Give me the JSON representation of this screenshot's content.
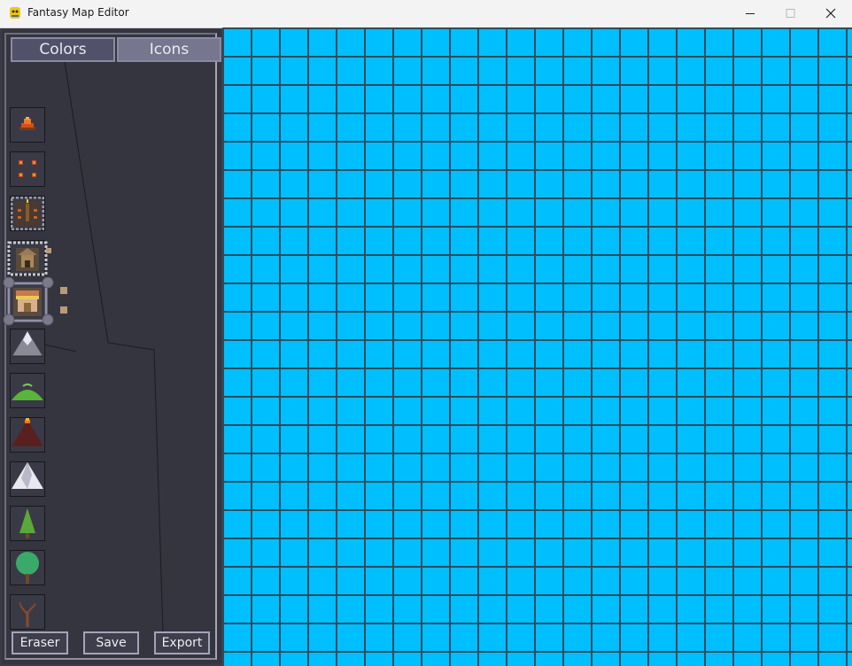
{
  "window": {
    "title": "Fantasy Map Editor",
    "controls": {
      "minimize": "minimize-icon",
      "maximize": "maximize-icon",
      "close": "close-icon"
    }
  },
  "sidebar": {
    "tabs": [
      {
        "label": "Colors",
        "active": false
      },
      {
        "label": "Icons",
        "active": true
      }
    ],
    "icons": [
      {
        "name": "campfire-icon"
      },
      {
        "name": "camp-lights-icon"
      },
      {
        "name": "fort-icon"
      },
      {
        "name": "castle-icon"
      },
      {
        "name": "palace-icon",
        "selected": true
      },
      {
        "name": "snow-mountain-icon"
      },
      {
        "name": "green-hill-icon"
      },
      {
        "name": "volcano-icon"
      },
      {
        "name": "white-mountain-icon"
      },
      {
        "name": "pine-tree-icon"
      },
      {
        "name": "round-tree-icon"
      },
      {
        "name": "dead-tree-icon"
      }
    ],
    "buttons": {
      "eraser": "Eraser",
      "save": "Save",
      "export": "Export"
    }
  },
  "map": {
    "fill_color": "#00bfff",
    "grid_line_color": "#2d4c60",
    "cell_size_px": 32
  },
  "colors": {
    "panel_bg": "#35353f",
    "tab_active": "#76768f",
    "tab_inactive": "#51516a"
  }
}
